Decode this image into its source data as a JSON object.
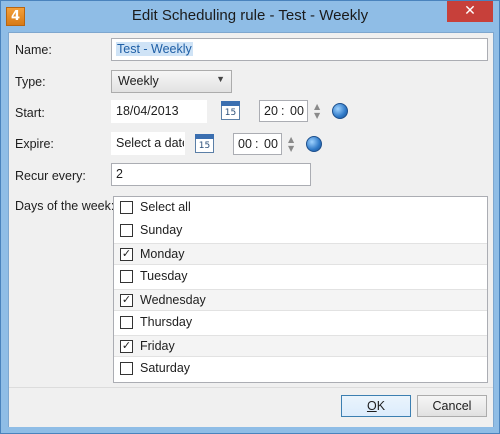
{
  "window": {
    "title": "Edit Scheduling rule - Test - Weekly",
    "app_icon_text": "4",
    "close_glyph": "✕"
  },
  "form": {
    "name_label": "Name:",
    "name_value": "Test - Weekly",
    "type_label": "Type:",
    "type_value": "Weekly",
    "start_label": "Start:",
    "start_date": "18/04/2013",
    "start_hour": "20",
    "start_minute": "00",
    "expire_label": "Expire:",
    "expire_date_placeholder": "Select a date",
    "expire_hour": "00",
    "expire_minute": "00",
    "recur_label": "Recur every:",
    "recur_value": "2",
    "days_label": "Days of the week:",
    "calendar_day": "15",
    "time_separator": ":"
  },
  "days": [
    {
      "label": "Select all",
      "checked": false
    },
    {
      "label": "Sunday",
      "checked": false
    },
    {
      "label": "Monday",
      "checked": true
    },
    {
      "label": "Tuesday",
      "checked": false
    },
    {
      "label": "Wednesday",
      "checked": true
    },
    {
      "label": "Thursday",
      "checked": false
    },
    {
      "label": "Friday",
      "checked": true
    },
    {
      "label": "Saturday",
      "checked": false
    }
  ],
  "buttons": {
    "ok_mnemonic": "O",
    "ok_rest": "K",
    "cancel": "Cancel"
  },
  "icons": {
    "dropdown": "chevron-down-icon",
    "calendar": "calendar-icon",
    "globe": "globe-icon",
    "spin_up": "▲",
    "spin_down": "▼"
  }
}
